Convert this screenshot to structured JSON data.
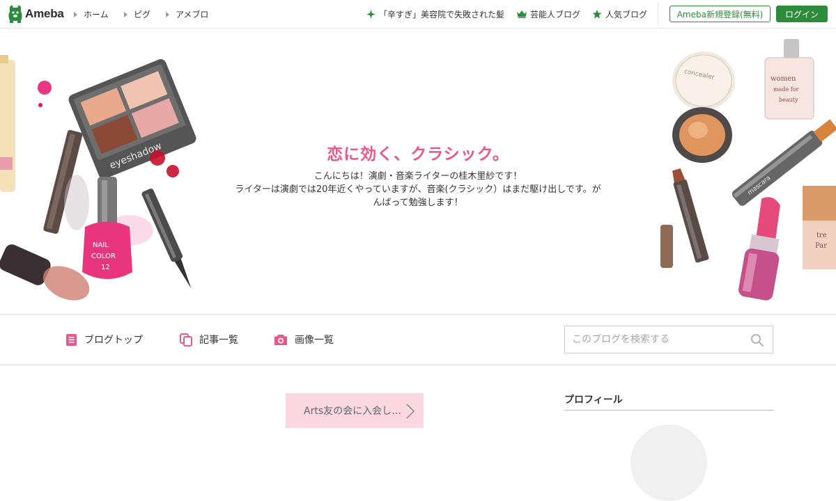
{
  "topbar": {
    "logo_text": "Ameba",
    "nav": [
      {
        "label": "ホーム"
      },
      {
        "label": "ピグ"
      },
      {
        "label": "アメブロ"
      }
    ],
    "topics": [
      {
        "icon": "sparkle-icon",
        "label": "「辛すぎ」美容院で失敗された髪"
      },
      {
        "icon": "crown-icon",
        "label": "芸能人ブログ"
      },
      {
        "icon": "star-icon",
        "label": "人気ブログ"
      }
    ],
    "register_label": "Ameba新規登録(無料)",
    "login_label": "ログイン"
  },
  "banner": {
    "title": "恋に効く、クラシック。",
    "description_lines": [
      "こんにちは！演劇・音楽ライターの桂木里紗です！",
      "ライターは演劇では20年近くやっていますが、音楽(クラシック）はまだ駆け出しです。が",
      "んばって勉強します！"
    ]
  },
  "navbar": {
    "items": [
      {
        "label": "ブログトップ",
        "icon": "document-icon"
      },
      {
        "label": "記事一覧",
        "icon": "copy-icon"
      },
      {
        "label": "画像一覧",
        "icon": "camera-icon"
      }
    ],
    "search": {
      "placeholder": "このブログを検索する"
    }
  },
  "main": {
    "article_button_label": "Arts友の会に入会し…"
  },
  "sidebar": {
    "profile_heading": "プロフィール"
  },
  "colors": {
    "brand_green": "#2d8c3c",
    "title_pink": "#e8578d",
    "nav_icon_pink": "#e8578d",
    "article_button_bg": "#fad7e1"
  }
}
